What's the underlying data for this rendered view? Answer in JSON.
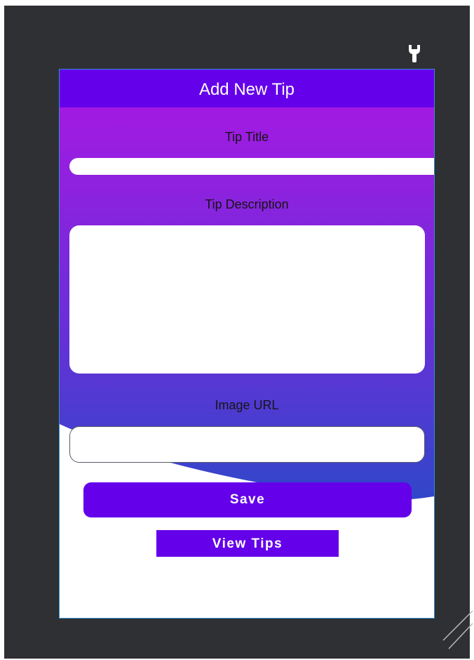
{
  "screen": {
    "title": "Add New Tip",
    "tip_title_label": "Tip Title",
    "tip_title_value": "",
    "tip_description_label": "Tip Description",
    "tip_description_value": "",
    "image_url_label": "Image URL",
    "image_url_value": "",
    "save_label": "Save",
    "view_tips_label": "View Tips"
  },
  "icons": {
    "toolbar": "wrench-icon",
    "corner": "resize-grip-icon"
  },
  "colors": {
    "editor_background": "#2f3033",
    "header": "#6400ea",
    "gradient_top": "#a21ae2",
    "gradient_bottom": "#3047c9",
    "button": "#6400ea",
    "selection_outline": "#2f8fd6"
  }
}
